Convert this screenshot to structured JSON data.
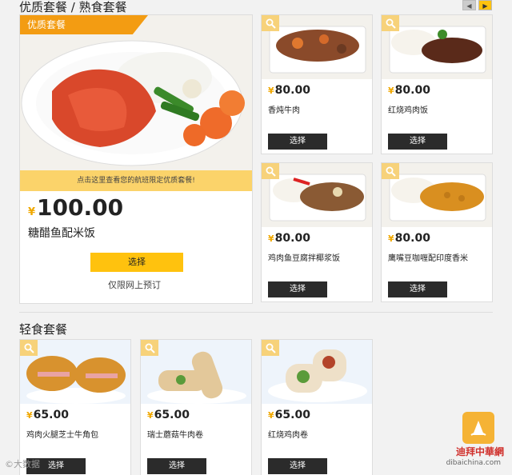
{
  "premium": {
    "section_title": "优质套餐 / 熟食套餐",
    "pager": {
      "prev": "◀",
      "next": "▶"
    },
    "featured": {
      "badge": "优质套餐",
      "banner": "点击这里查看您的航班限定优质套餐!",
      "currency": "¥",
      "price": "100.00",
      "name": "糖醋鱼配米饭",
      "select": "选择",
      "note": "仅限网上预订"
    },
    "items": [
      {
        "currency": "¥",
        "price": "80.00",
        "name": "香炖牛肉",
        "select": "选择"
      },
      {
        "currency": "¥",
        "price": "80.00",
        "name": "红烧鸡肉饭",
        "select": "选择"
      },
      {
        "currency": "¥",
        "price": "80.00",
        "name": "鸡肉鱼豆腐拌椰浆饭",
        "select": "选择"
      },
      {
        "currency": "¥",
        "price": "80.00",
        "name": "鹰嘴豆咖喱配印度香米",
        "select": "选择"
      }
    ]
  },
  "light": {
    "section_title": "轻食套餐",
    "items": [
      {
        "currency": "¥",
        "price": "65.00",
        "name": "鸡肉火腿芝士牛角包",
        "select": "选择"
      },
      {
        "currency": "¥",
        "price": "65.00",
        "name": "瑞士蘑菇牛肉卷",
        "select": "选择"
      },
      {
        "currency": "¥",
        "price": "65.00",
        "name": "红烧鸡肉卷",
        "select": "选择"
      }
    ]
  },
  "watermark": {
    "left": "©大数据",
    "brand": "迪拜中華網",
    "url": "dibaichina.com"
  },
  "icons": {
    "zoom": "magnifier-icon"
  },
  "colors": {
    "accent": "#ffc20e",
    "badge": "#f39c12",
    "button_dark": "#2b2b2b",
    "yen": "#f0a800"
  }
}
